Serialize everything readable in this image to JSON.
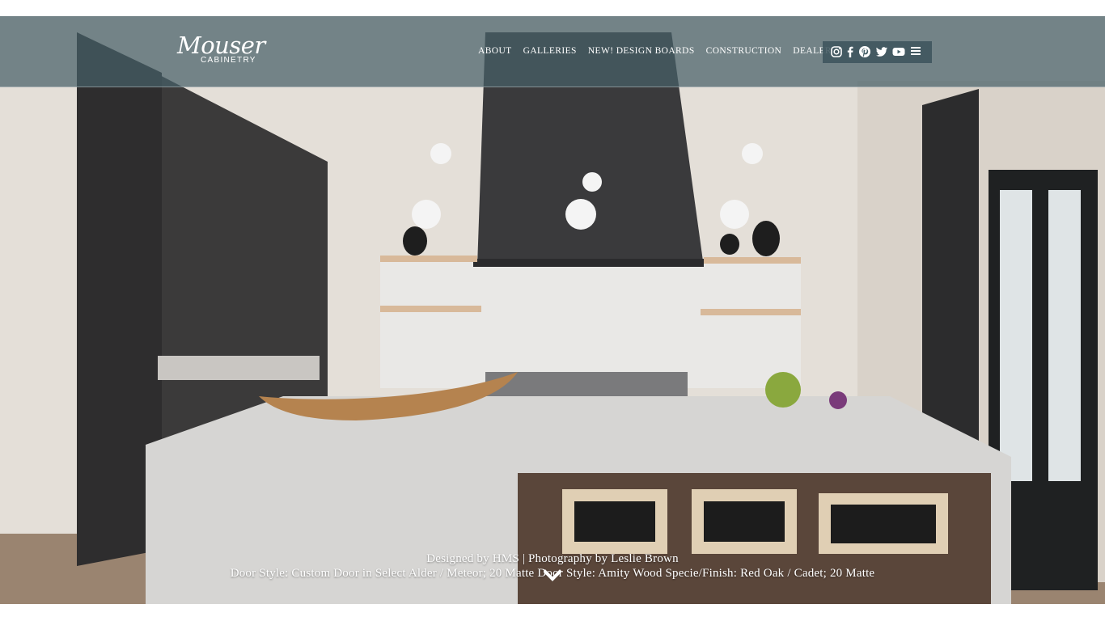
{
  "brand": {
    "logo_script": "Mouser",
    "logo_sub": "CABINETRY"
  },
  "nav": {
    "items": [
      {
        "label": "ABOUT"
      },
      {
        "label": "GALLERIES"
      },
      {
        "label": "NEW! DESIGN BOARDS"
      },
      {
        "label": "CONSTRUCTION"
      },
      {
        "label": "DEALER"
      }
    ]
  },
  "social": {
    "icons": [
      "instagram-icon",
      "facebook-icon",
      "pinterest-icon",
      "twitter-icon",
      "youtube-icon",
      "menu-icon"
    ]
  },
  "hero": {
    "caption_line1": "Designed by HMS | Photography by Leslie Brown",
    "caption_line2": "Door Style: Custom Door in Select Alder / Meteor; 20 Matte Door Style: Amity Wood Specie/Finish: Red Oak / Cadet; 20 Matte"
  },
  "colors": {
    "header_overlay": "#466068",
    "text": "#ffffff"
  }
}
